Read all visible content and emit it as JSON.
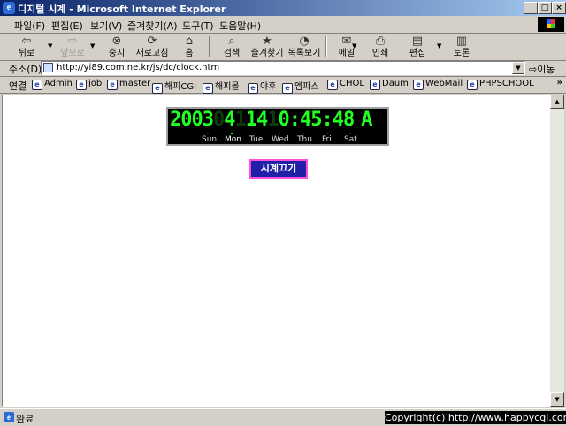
{
  "window": {
    "title": "디지털 시계 - Microsoft Internet Explorer",
    "min_glyph": "_",
    "max_glyph": "□",
    "close_glyph": "×"
  },
  "menu": [
    "파일(F)",
    "편집(E)",
    "보기(V)",
    "즐겨찾기(A)",
    "도구(T)",
    "도움말(H)"
  ],
  "toolbar": {
    "back": "뒤로",
    "forward": "앞으로",
    "stop": "중지",
    "refresh": "새로고침",
    "home": "홈",
    "search": "검색",
    "favorites": "즐겨찾기",
    "history": "목록보기",
    "mail": "메일",
    "print": "인쇄",
    "edit": "편집",
    "discuss": "토론"
  },
  "address": {
    "label": "주소(D)",
    "url": "http://yi89.com.ne.kr/js/dc/clock.htm",
    "go_label": "이동"
  },
  "links": {
    "label": "연결",
    "items": [
      "Admin",
      "job",
      "master",
      "해피CGI",
      "해피몰",
      "야후",
      "엠파스",
      "CHOL",
      "Daum",
      "WebMail",
      "PHPSCHOOL"
    ],
    "more": "»"
  },
  "clock": {
    "year": "2003",
    "month_off": "0",
    "month": "4",
    "day_off": "1",
    "day": "14",
    "hour_off": "1",
    "time": "0:45:48",
    "ampm": "A",
    "weekdays": [
      "Sun",
      "Mon",
      "Tue",
      "Wed",
      "Thu",
      "Fri",
      "Sat"
    ],
    "active_weekday_index": 1,
    "led_color": "#22ff22"
  },
  "page": {
    "off_button": "시계끄기"
  },
  "status": {
    "text": "완료",
    "copyright": "Copyright(c) http://www.happycgi.com"
  }
}
